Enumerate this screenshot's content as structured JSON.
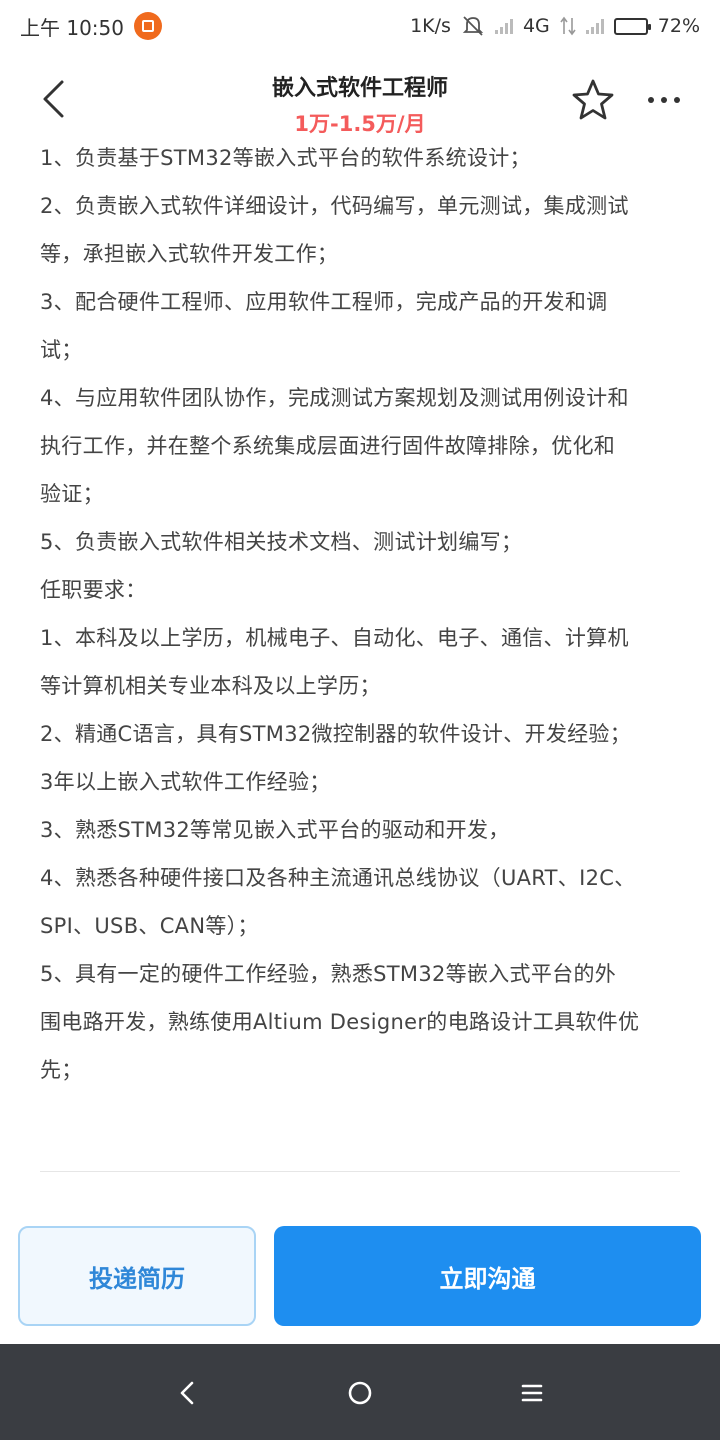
{
  "status_bar": {
    "time": "上午 10:50",
    "speed": "1K/s",
    "network": "4G",
    "battery": "72%",
    "battery_level": 0.72
  },
  "header": {
    "title": "嵌入式软件工程师",
    "salary": "1万-1.5万/月"
  },
  "description": {
    "lines": [
      "1、负责基于STM32等嵌入式平台的软件系统设计；",
      "2、负责嵌入式软件详细设计，代码编写，单元测试，集成测试",
      "等，承担嵌入式软件开发工作；",
      "3、配合硬件工程师、应用软件工程师，完成产品的开发和调",
      "试；",
      "4、与应用软件团队协作，完成测试方案规划及测试用例设计和",
      "执行工作，并在整个系统集成层面进行固件故障排除，优化和",
      "验证；",
      "5、负责嵌入式软件相关技术文档、测试计划编写；",
      "任职要求：",
      "1、本科及以上学历，机械电子、自动化、电子、通信、计算机",
      "等计算机相关专业本科及以上学历；",
      "2、精通C语言，具有STM32微控制器的软件设计、开发经验；",
      "3年以上嵌入式软件工作经验；",
      "3、熟悉STM32等常见嵌入式平台的驱动和开发，",
      "4、熟悉各种硬件接口及各种主流通讯总线协议（UART、I2C、",
      "SPI、USB、CAN等）；",
      "5、具有一定的硬件工作经验，熟悉STM32等嵌入式平台的外",
      "围电路开发，熟练使用Altium Designer的电路设计工具软件优",
      "先；"
    ]
  },
  "actions": {
    "resume_label": "投递简历",
    "chat_label": "立即沟通"
  },
  "colors": {
    "salary": "#f45b5b",
    "primary": "#1e8ef0",
    "nav_bar": "#3a3d42"
  }
}
